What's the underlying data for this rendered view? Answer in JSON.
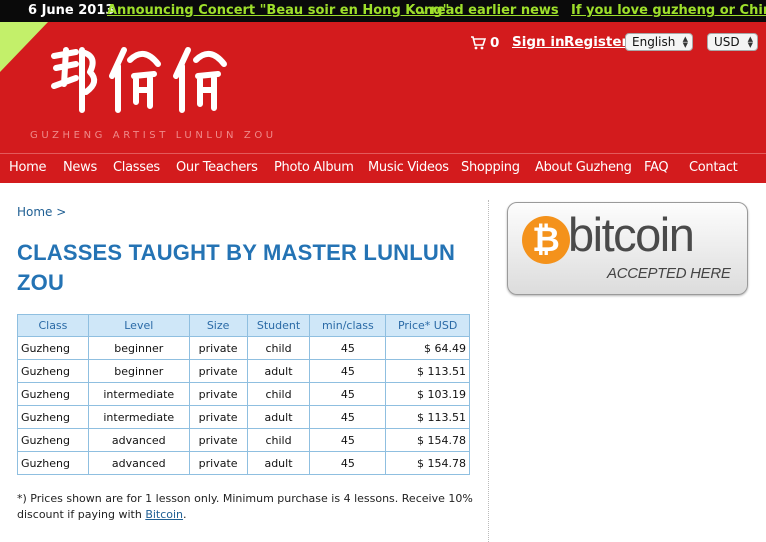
{
  "ticker": {
    "date": "6 June 2013",
    "items": [
      "Announcing Concert \"Beau soir en Hong Kong\"",
      "... read earlier news",
      "If you love guzheng or Chinese mu"
    ]
  },
  "header": {
    "logo_text": "邹伦伦",
    "tagline": "GUZHENG ARTIST LUNLUN ZOU",
    "cart_count": "0",
    "signin": "Sign in",
    "register": "Register",
    "language": "English",
    "currency": "USD"
  },
  "nav": [
    "Home",
    "News",
    "Classes",
    "Our Teachers",
    "Photo Album",
    "Music Videos",
    "Shopping",
    "About Guzheng",
    "FAQ",
    "Contact"
  ],
  "breadcrumb": {
    "home": "Home",
    "separator": ">"
  },
  "page_title": "CLASSES TAUGHT BY MASTER LUNLUN ZOU",
  "table": {
    "headers": [
      "Class",
      "Level",
      "Size",
      "Student",
      "min/class",
      "Price* USD"
    ],
    "rows": [
      [
        "Guzheng",
        "beginner",
        "private",
        "child",
        "45",
        "$ 64.49"
      ],
      [
        "Guzheng",
        "beginner",
        "private",
        "adult",
        "45",
        "$ 113.51"
      ],
      [
        "Guzheng",
        "intermediate",
        "private",
        "child",
        "45",
        "$ 103.19"
      ],
      [
        "Guzheng",
        "intermediate",
        "private",
        "adult",
        "45",
        "$ 113.51"
      ],
      [
        "Guzheng",
        "advanced",
        "private",
        "child",
        "45",
        "$ 154.78"
      ],
      [
        "Guzheng",
        "advanced",
        "private",
        "adult",
        "45",
        "$ 154.78"
      ]
    ]
  },
  "note": {
    "text": "*) Prices shown are for 1 lesson only. Minimum purchase is 4 lessons. Receive 10% discount if paying with ",
    "link": "Bitcoin",
    "end": "."
  },
  "bitcoin_badge": {
    "symbol": "₿",
    "word": "bitcoin",
    "accepted": "ACCEPTED HERE"
  },
  "colors": {
    "header_red": "#d31b1d",
    "ticker_green": "#9ee02b",
    "title_blue": "#2473b4",
    "bitcoin_orange": "#f4921b"
  }
}
